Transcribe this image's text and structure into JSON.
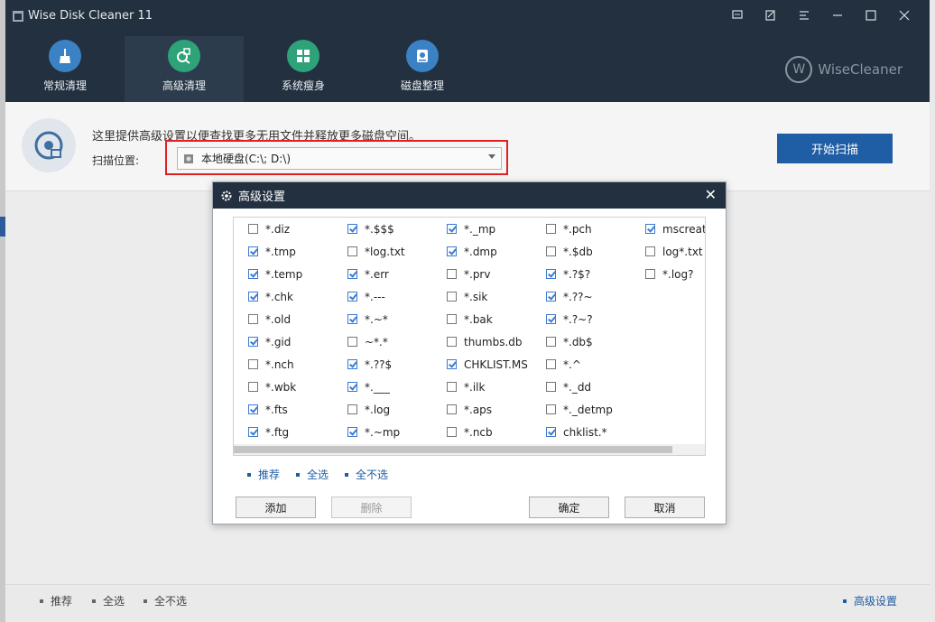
{
  "app": {
    "title": "Wise Disk Cleaner 11"
  },
  "window_controls": [
    "chat-icon",
    "feedback-icon",
    "menu-icon",
    "minimize-icon",
    "maximize-icon",
    "close-icon"
  ],
  "nav": [
    {
      "label": "常规清理",
      "icon": "broom-icon",
      "color": "#3b82c4",
      "active": false
    },
    {
      "label": "高级清理",
      "icon": "search-trash-icon",
      "color": "#2ea37a",
      "active": true
    },
    {
      "label": "系统瘦身",
      "icon": "windows-icon",
      "color": "#2ea37a",
      "active": false
    },
    {
      "label": "磁盘整理",
      "icon": "disk-defrag-icon",
      "color": "#3b82c4",
      "active": false
    }
  ],
  "brand": {
    "mark": "W",
    "name": "WiseCleaner"
  },
  "info": {
    "description": "这里提供高级设置以便查找更多无用文件并释放更多磁盘空间。",
    "scan_label": "扫描位置:",
    "location_value": "本地硬盘(C:\\; D:\\)",
    "start_button": "开始扫描"
  },
  "bottom": {
    "recommend": "推荐",
    "select_all": "全选",
    "select_none": "全不选",
    "advanced_settings": "高级设置"
  },
  "modal": {
    "title": "高级设置",
    "columns": [
      [
        {
          "label": "*.diz",
          "checked": false
        },
        {
          "label": "*.tmp",
          "checked": true
        },
        {
          "label": "*.temp",
          "checked": true
        },
        {
          "label": "*.chk",
          "checked": true
        },
        {
          "label": "*.old",
          "checked": false
        },
        {
          "label": "*.gid",
          "checked": true
        },
        {
          "label": "*.nch",
          "checked": false
        },
        {
          "label": "*.wbk",
          "checked": false
        },
        {
          "label": "*.fts",
          "checked": true
        },
        {
          "label": "*.ftg",
          "checked": true
        }
      ],
      [
        {
          "label": "*.$$$",
          "checked": true
        },
        {
          "label": "*log.txt",
          "checked": false
        },
        {
          "label": "*.err",
          "checked": true
        },
        {
          "label": "*.---",
          "checked": true
        },
        {
          "label": "*.~*",
          "checked": true
        },
        {
          "label": "~*.*",
          "checked": false
        },
        {
          "label": "*.??$",
          "checked": true
        },
        {
          "label": "*.___",
          "checked": true
        },
        {
          "label": "*.log",
          "checked": false
        },
        {
          "label": "*.~mp",
          "checked": true
        }
      ],
      [
        {
          "label": "*._mp",
          "checked": true
        },
        {
          "label": "*.dmp",
          "checked": true
        },
        {
          "label": "*.prv",
          "checked": false
        },
        {
          "label": "*.sik",
          "checked": false
        },
        {
          "label": "*.bak",
          "checked": false
        },
        {
          "label": "thumbs.db",
          "checked": false
        },
        {
          "label": "CHKLIST.MS",
          "checked": true
        },
        {
          "label": "*.ilk",
          "checked": false
        },
        {
          "label": "*.aps",
          "checked": false
        },
        {
          "label": "*.ncb",
          "checked": false
        }
      ],
      [
        {
          "label": "*.pch",
          "checked": false
        },
        {
          "label": "*.$db",
          "checked": false
        },
        {
          "label": "*.?$?",
          "checked": true
        },
        {
          "label": "*.??~",
          "checked": true
        },
        {
          "label": "*.?~?",
          "checked": true
        },
        {
          "label": "*.db$",
          "checked": false
        },
        {
          "label": "*.^",
          "checked": false
        },
        {
          "label": "*._dd",
          "checked": false
        },
        {
          "label": "*._detmp",
          "checked": false
        },
        {
          "label": "chklist.*",
          "checked": true
        }
      ],
      [
        {
          "label": "mscreat",
          "checked": true
        },
        {
          "label": "log*.txt",
          "checked": false
        },
        {
          "label": "*.log?",
          "checked": false
        }
      ]
    ],
    "links": {
      "recommend": "推荐",
      "select_all": "全选",
      "select_none": "全不选"
    },
    "buttons": {
      "add": "添加",
      "delete": "删除",
      "ok": "确定",
      "cancel": "取消"
    }
  }
}
